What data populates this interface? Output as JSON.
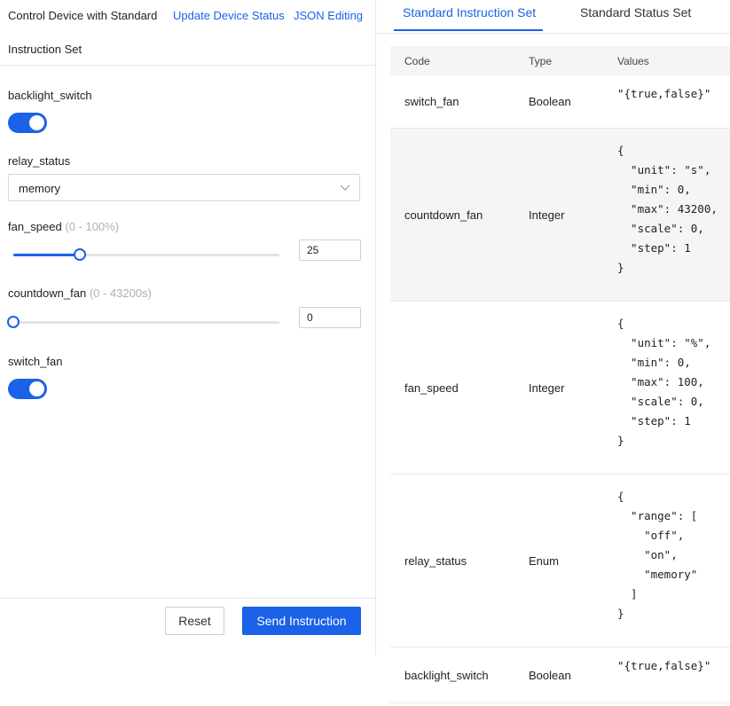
{
  "header": {
    "title_line1": "Control Device with Standard",
    "title_line2": "Instruction Set",
    "link_update": "Update Device Status",
    "link_json": "JSON Editing"
  },
  "form": {
    "backlight_switch": {
      "label": "backlight_switch",
      "on": true
    },
    "relay_status": {
      "label": "relay_status",
      "value": "memory"
    },
    "fan_speed": {
      "label": "fan_speed",
      "range": "(0 - 100%)",
      "value": "25",
      "fraction": 0.25
    },
    "countdown_fan": {
      "label": "countdown_fan",
      "range": "(0 - 43200s)",
      "value": "0",
      "fraction": 0
    },
    "switch_fan": {
      "label": "switch_fan",
      "on": true
    }
  },
  "footer": {
    "reset_label": "Reset",
    "send_label": "Send Instruction"
  },
  "tabs": {
    "instruction": "Standard Instruction Set",
    "status": "Standard Status Set",
    "active": "instruction"
  },
  "table": {
    "headers": {
      "code": "Code",
      "type": "Type",
      "values": "Values"
    },
    "rows": [
      {
        "code": "switch_fan",
        "type": "Boolean",
        "values": "\"{true,false}\""
      },
      {
        "code": "countdown_fan",
        "type": "Integer",
        "values": "{\n  \"unit\": \"s\",\n  \"min\": 0,\n  \"max\": 43200,\n  \"scale\": 0,\n  \"step\": 1\n}"
      },
      {
        "code": "fan_speed",
        "type": "Integer",
        "values": "{\n  \"unit\": \"%\",\n  \"min\": 0,\n  \"max\": 100,\n  \"scale\": 0,\n  \"step\": 1\n}"
      },
      {
        "code": "relay_status",
        "type": "Enum",
        "values": "{\n  \"range\": [\n    \"off\",\n    \"on\",\n    \"memory\"\n  ]\n}"
      },
      {
        "code": "backlight_switch",
        "type": "Boolean",
        "values": "\"{true,false}\""
      }
    ]
  },
  "colors": {
    "accent": "#1a62e8",
    "row_highlight": "#f5f5f5",
    "muted": "#b0b0b0"
  }
}
